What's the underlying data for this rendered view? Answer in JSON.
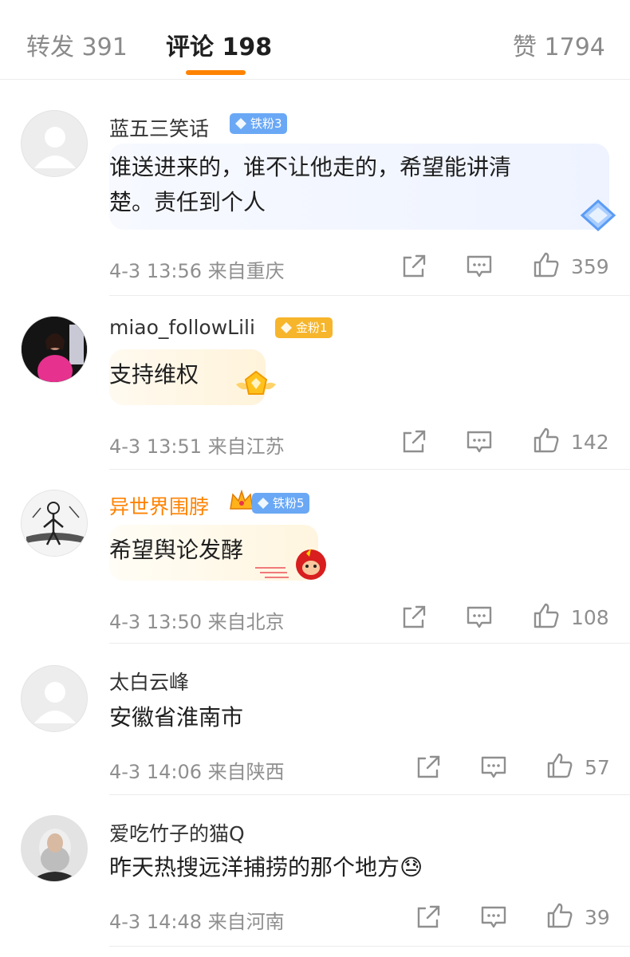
{
  "tabs": {
    "repost": "转发 391",
    "comments": "评论 198",
    "likes": "赞 1794"
  },
  "colors": {
    "accent": "#ff8200",
    "iron_badge": "#6aa8f5",
    "gold_badge": "#f7b52b"
  },
  "comments": [
    {
      "username": "蓝五三笑话",
      "badge": "铁粉3",
      "text_line1": "谁送进来的，谁不让他走的，希望能讲清",
      "text_line2": "楚。责任到个人",
      "time": "4-3 13:56 来自重庆",
      "likes": "359",
      "avatar": "default-avatar"
    },
    {
      "username": "miao_followLili",
      "badge": "金粉1",
      "text_line1": "支持维权",
      "time": "4-3 13:51 来自江苏",
      "likes": "142",
      "avatar": "photo-avatar"
    },
    {
      "username": "异世界围脖",
      "badge": "铁粉5",
      "text_line1": "希望舆论发酵",
      "time": "4-3 13:50 来自北京",
      "likes": "108",
      "avatar": "sketch-avatar"
    },
    {
      "username": "太白云峰",
      "text_line1": "安徽省淮南市",
      "time": "4-3 14:06 来自陕西",
      "likes": "57",
      "avatar": "default-avatar"
    },
    {
      "username": "爱吃竹子的猫Q",
      "text_line1": "昨天热搜远洋捕捞的那个地方😓",
      "time": "4-3 14:48 来自河南",
      "likes": "39",
      "avatar": "portrait-avatar"
    }
  ]
}
